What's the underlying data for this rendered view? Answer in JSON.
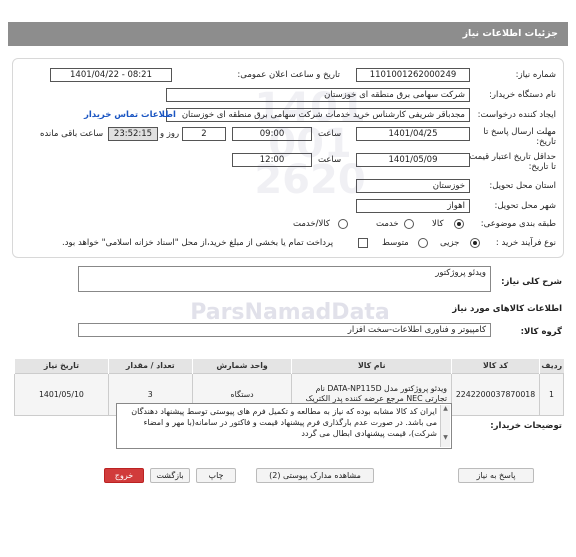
{
  "header": {
    "title": "جزئیات اطلاعات نیاز"
  },
  "form": {
    "need_number_label": "شماره نیاز:",
    "need_number": "1101001262000249",
    "announce_label": "تاریخ و ساعت اعلان عمومی:",
    "announce_value": "1401/04/22 - 08:21",
    "buyer_label": "نام دستگاه خریدار:",
    "buyer_value": "شرکت سهامی برق منطقه ای خوزستان",
    "creator_label": "ایجاد کننده درخواست:",
    "creator_value": "مجدباقر شریفی کارشناس خرید خدمات شرکت سهامی برق منطقه ای خوزستان",
    "contact_link": "اطلاعات تماس خریدار",
    "deadline_label": "مهلت ارسال پاسخ تا تاریخ:",
    "deadline_date": "1401/04/25",
    "deadline_time_label": "ساعت",
    "deadline_time": "09:00",
    "days_value": "2",
    "days_label": "روز و",
    "remaining_time": "23:52:15",
    "remaining_label": "ساعت باقی مانده",
    "validity_label": "حداقل تاریخ اعتبار قیمت: تا تاریخ:",
    "validity_date": "1401/05/09",
    "validity_time_label": "ساعت",
    "validity_time": "12:00",
    "province_label": "استان محل تحویل:",
    "province_value": "خوزستان",
    "city_label": "شهر محل تحویل:",
    "city_value": "اهواز",
    "category_label": "طبقه بندی موضوعی:",
    "category_goods": "کالا",
    "category_service": "خدمت",
    "category_both": "کالا/خدمت",
    "process_label": "نوع فرآیند خرید :",
    "process_partial": "جزیی",
    "process_medium": "متوسط",
    "process_note": "پرداخت تمام یا بخشی از مبلغ خرید،از محل \"اسناد خزانه اسلامی\" خواهد بود."
  },
  "summary": {
    "label": "شرح کلی نیاز:",
    "value": "ویدئو پروژکتور"
  },
  "goods_info_title": "اطلاعات کالاهای مورد نیاز",
  "group": {
    "label": "گروه کالا:",
    "value": "کامپیوتر و فناوری اطلاعات-سخت افزار"
  },
  "table": {
    "headers": [
      "ردیف",
      "کد کالا",
      "نام کالا",
      "واحد شمارش",
      "تعداد / مقدار",
      "تاریخ نیاز"
    ],
    "rows": [
      {
        "row": "1",
        "code": "2242200037870018",
        "name": "ویدئو پروژکتور مدل DATA-NP115D نام تجارتی NEC مرجع عرضه کننده پدر الکتریک",
        "unit": "دستگاه",
        "qty": "3",
        "date": "1401/05/10"
      }
    ]
  },
  "buyer_notes": {
    "label": "توضیحات خریدار:",
    "text": "ایران کد کالا مشابه بوده که نیاز به مطالعه و تکمیل فرم های پیوستی توسط پیشنهاد دهندگان می باشد. در صورت عدم بارگذاری فرم پیشنهاد قیمت و فاکتور در سامانه(با مهر و امضاء شرکت)، قیمت پیشنهادی ابطال می گردد"
  },
  "buttons": {
    "reply": "پاسخ به نیاز",
    "attachments": "مشاهده مدارک پیوستی (2)",
    "print": "چاپ",
    "back": "بازگشت",
    "exit": "خروج"
  },
  "watermark": "ParsNamadData"
}
